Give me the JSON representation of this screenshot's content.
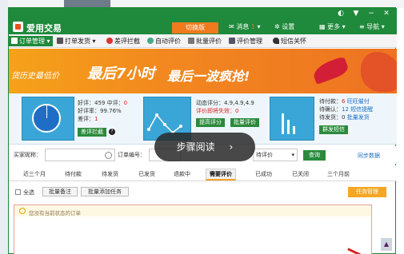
{
  "window": {
    "title": "爱用交易",
    "hint_button": "切换版",
    "message_label": "消息",
    "message_count": "1",
    "settings_label": "设置",
    "more_label": "更多",
    "nav_label": "导航"
  },
  "toolbar": {
    "items": [
      {
        "label": "订单管理",
        "icon": "order-icon"
      },
      {
        "label": "打单发货",
        "icon": "print-icon"
      },
      {
        "label": "差评拦截",
        "icon": "block-icon"
      },
      {
        "label": "自动评价",
        "icon": "auto-review-icon"
      },
      {
        "label": "批量评价",
        "icon": "batch-review-icon"
      },
      {
        "label": "评价管理",
        "icon": "review-manage-icon"
      },
      {
        "label": "短信关怀",
        "icon": "heart-icon"
      }
    ]
  },
  "banner": {
    "sub_text": "货历史最低价",
    "main_text": "最后7小时",
    "main_text2": "最后一波疯抢!"
  },
  "stats": {
    "good_prefix": "好评：",
    "good_value": "459",
    "mid_prefix": " 中评：",
    "mid_value": "0",
    "rate_prefix": "好评率：",
    "rate_value": "99.76%",
    "bad_prefix": "差评：",
    "bad_value": "1",
    "intercept_btn": "差评拦截",
    "dsr_text": "动态评分：4.9,4.9,4.9",
    "fail_text": "评价即将失效：0",
    "raise_btn": "提高评分",
    "batch_btn": "批量评价",
    "pay_prefix": "待付款：",
    "pay_value": "6",
    "pay_link": "旺旺催付",
    "confirm_prefix": "待确认：",
    "confirm_value": "12",
    "confirm_link": "短信提醒",
    "ship_prefix": "待发货：",
    "ship_value": "0",
    "ship_link": "批量发货",
    "sms_btn": "群发短信"
  },
  "search": {
    "buyer_label": "买家昵称：",
    "order_label": "订单编号：",
    "review_select": "待评价",
    "query_btn": "查询",
    "sync_link": "同步数据"
  },
  "overlay": {
    "text": "步骤阅读",
    "arrow": "›"
  },
  "tabs": [
    "近三个月",
    "待付款",
    "待发货",
    "已发货",
    "退款中",
    "需要评价",
    "已成功",
    "已关闭",
    "三个月前"
  ],
  "actions": {
    "select_all": "全选",
    "batch_note": "批量备注",
    "batch_task": "批量添加任务",
    "task_manage": "任务管理"
  },
  "empty": {
    "message": "您没有当前状态的订单"
  },
  "scroll": {
    "up_arrow": "▲"
  }
}
